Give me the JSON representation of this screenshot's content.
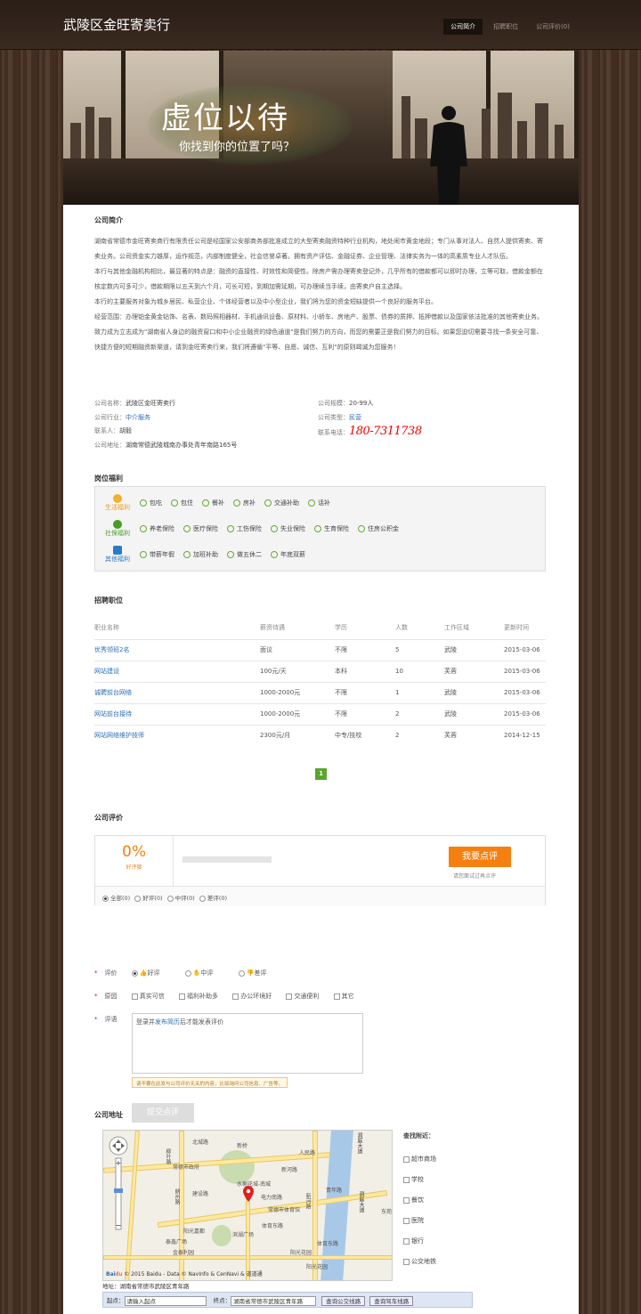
{
  "header": {
    "logo": "武陵区金旺寄卖行",
    "nav": [
      "公司简介",
      "招聘职位",
      "公司评价(0)"
    ]
  },
  "banner": {
    "title": "虚位以待",
    "subtitle": "你找到你的位置了吗？"
  },
  "intro": {
    "heading": "公司简介",
    "paragraphs": [
      "湖南省常德市金旺寄卖商行有限责任公司是经国家公安部商务部批准成立的大型寄卖融资特种行业机构，地处闹市黄金地段；专门从事对法人、自然人提供寄卖、寄卖业务。公司资金实力雄厚，运作规范，内部制度健全，社会信誉卓著。拥有资产评估、金融证券、企业管理、法律实务为一体的高素质专业人才队伍。",
      "本行与其他金融机构相比，最显著的特点是：融资的直接性、时效性和简便性。除房产需办理寄卖登记外，几乎所有的借款都可以即时办理，立等可取，借款金额在核定数内可多可少，借款期限以五天到六个月，可长可短，到期加需延期，可办理续当手续，由寄卖户自主选择。",
      "本行的主要服务对象为城乡居民、私营企业、个体经营者以及中小型企业，我们将为您的资金短缺提供一个良好的服务平台。",
      "经营范围：办理铂金黄金钻饰、名表、数码照相器材、手机通讯设备、原材料、小轿车、房地产、股票、债券的质押、抵押借款以及国家依法批准的其他寄卖业务。",
      "致力成为立志成为\"湖南省人身边的融资窗口和中小企业融资的绿色通道\"是我们努力的方向，而您的需要正是我们努力的目标。如果您迫切需要寻找一条安全可靠、快捷方便的短期融资新渠道，请到金旺寄卖行来，我们将遵循\"平等、自愿、诚信、互利\"的原则竭诚为您服务！"
    ]
  },
  "info": {
    "name_label": "公司名称：",
    "name": "武陵区金旺寄卖行",
    "industry_label": "公司行业：",
    "industry": "中介服务",
    "contact_label": "联系人：",
    "contact": "胡毅",
    "address_label": "公司地址：",
    "address": "湖南常德武陵城南办事处青年南路165号",
    "scale_label": "公司规模：",
    "scale": "20-99人",
    "type_label": "公司类型：",
    "type": "民营",
    "phone_label": "联系电话：",
    "phone": "180-7311738"
  },
  "welfare": {
    "heading": "岗位福利",
    "rows": [
      {
        "cat": "生活福利",
        "items": [
          "包吃",
          "包住",
          "餐补",
          "房补",
          "交通补助",
          "话补"
        ]
      },
      {
        "cat": "社保福利",
        "items": [
          "养老保险",
          "医疗保险",
          "工伤保险",
          "失业保险",
          "生育保险",
          "住房公积金"
        ]
      },
      {
        "cat": "其他福利",
        "items": [
          "带薪年假",
          "加班补助",
          "做五休二",
          "年底双薪"
        ]
      }
    ]
  },
  "jobs": {
    "heading": "招聘职位",
    "columns": [
      "职业名称",
      "薪资待遇",
      "学历",
      "人数",
      "工作区域",
      "更新时间"
    ],
    "rows": [
      [
        "优秀领班2名",
        "面议",
        "不限",
        "5",
        "武陵",
        "2015-03-06"
      ],
      [
        "网站建设",
        "100元/天",
        "本科",
        "10",
        "芙蓉",
        "2015-03-06"
      ],
      [
        "诚聘前台网络",
        "1000-2000元",
        "不限",
        "1",
        "武陵",
        "2015-03-06"
      ],
      [
        "网站前台接待",
        "1000-2000元",
        "不限",
        "2",
        "武陵",
        "2015-03-06"
      ],
      [
        "网站网络维护技师",
        "2300元/月",
        "中专/技校",
        "2",
        "芙蓉",
        "2014-12-15"
      ]
    ],
    "page": "1"
  },
  "review": {
    "heading": "公司评价",
    "percent": "0%",
    "percent_label": "好评度",
    "button": "我要点评",
    "button_note": "请您面试过再点评",
    "filters": [
      "全部(0)",
      "好评(0)",
      "中评(0)",
      "差评(0)"
    ],
    "rate_label": "评价",
    "rates": [
      "好评",
      "中评",
      "差评"
    ],
    "reason_label": "原因",
    "reasons": [
      "真实可信",
      "福利补助多",
      "办公环境好",
      "交通便利",
      "其它"
    ],
    "comment_label": "评语",
    "comment_pre": "登录并",
    "comment_link": "发布简历",
    "comment_post": "后才能发表评价",
    "notice": "请不要在此发与公司评价无关的内容，比如询问公司信息、广告等。",
    "submit": "提交点评"
  },
  "address": {
    "heading": "公司地址",
    "nearby_title": "查找附近：",
    "nearby": [
      "超市商场",
      "学校",
      "餐饮",
      "医院",
      "银行",
      "公交地铁"
    ],
    "map_address": "地址：湖南省常德市武陵区青年路",
    "copyright": "© 2015 Baidu - Data © NavInfo & CenNavi & 道道通",
    "start_label": "起点：",
    "start_value": "请输入起点",
    "end_label": "终点：",
    "end_value": "湖南省常德市武陵区青年路",
    "bus_btn": "查询公交线路",
    "drive_btn": "查询驾车线路",
    "labels": [
      "常德市政府",
      "新桥",
      "北城路",
      "人民路",
      "新河路",
      "电力南路",
      "水榭花城-南城",
      "常德市体育馆",
      "阳光嘉都",
      "泰鑫广场",
      "阳光花园",
      "滨湖广场",
      "金泰利园",
      "体育东路",
      "体育东路",
      "洞庭大道",
      "洞庭大道",
      "东苑",
      "青年路",
      "建设路",
      "新河路",
      "朗州路",
      "柳叶路",
      "阳光花园"
    ]
  }
}
